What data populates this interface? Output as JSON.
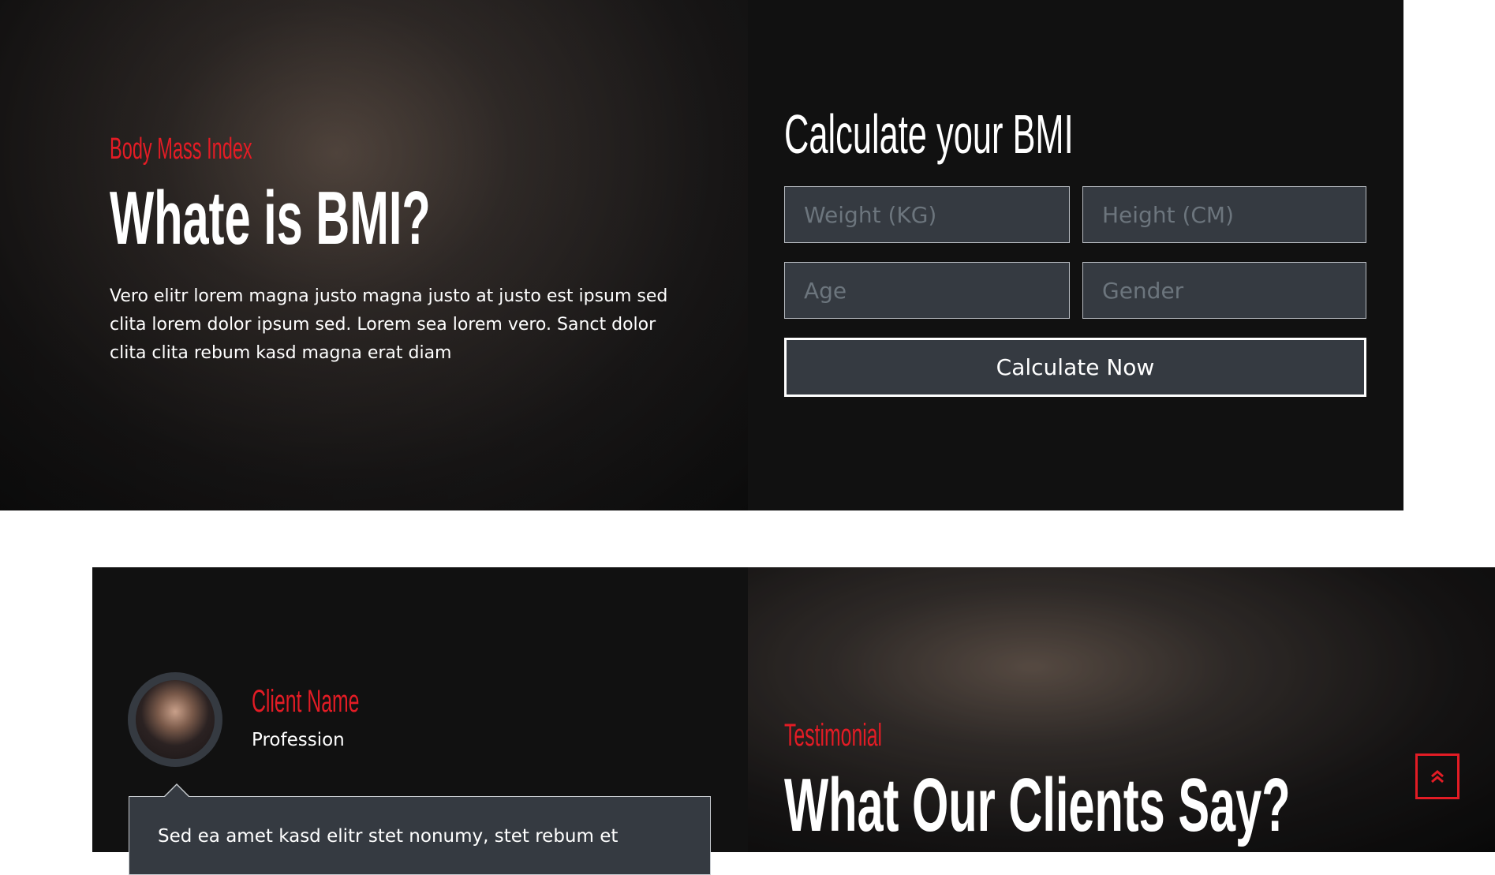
{
  "bmi_info": {
    "subtitle": "Body Mass Index",
    "title": "Whate is BMI?",
    "text": "Vero elitr lorem magna justo magna justo at justo est ipsum sed clita lorem dolor ipsum sed. Lorem sea lorem vero. Sanct dolor clita clita rebum kasd magna erat diam"
  },
  "calculator": {
    "title": "Calculate your BMI",
    "weight_placeholder": "Weight (KG)",
    "height_placeholder": "Height (CM)",
    "age_placeholder": "Age",
    "gender_placeholder": "Gender",
    "button": "Calculate Now"
  },
  "testimonial": {
    "client_name": "Client Name",
    "profession": "Profession",
    "quote": "Sed ea amet kasd elitr stet nonumy, stet rebum et",
    "label": "Testimonial",
    "title": "What Our Clients Say?"
  },
  "colors": {
    "accent": "#e31c25",
    "dark": "#111111",
    "field": "#353a41"
  },
  "icons": {
    "back_to_top": "double-chevron-up-icon"
  }
}
